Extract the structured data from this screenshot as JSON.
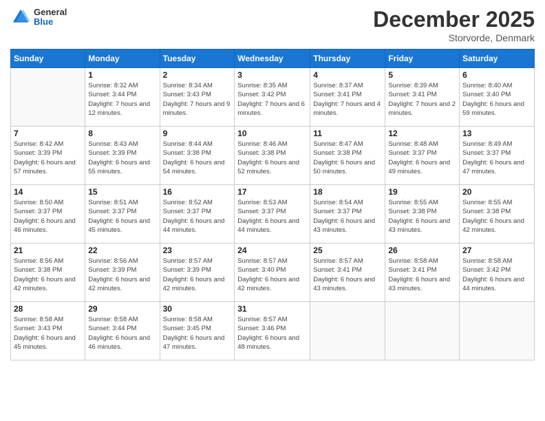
{
  "header": {
    "logo": {
      "general": "General",
      "blue": "Blue"
    },
    "title": "December 2025",
    "subtitle": "Storvorde, Denmark"
  },
  "calendar": {
    "days_of_week": [
      "Sunday",
      "Monday",
      "Tuesday",
      "Wednesday",
      "Thursday",
      "Friday",
      "Saturday"
    ],
    "weeks": [
      [
        {
          "day": "",
          "sunrise": "",
          "sunset": "",
          "daylight": ""
        },
        {
          "day": "1",
          "sunrise": "Sunrise: 8:32 AM",
          "sunset": "Sunset: 3:44 PM",
          "daylight": "Daylight: 7 hours and 12 minutes."
        },
        {
          "day": "2",
          "sunrise": "Sunrise: 8:34 AM",
          "sunset": "Sunset: 3:43 PM",
          "daylight": "Daylight: 7 hours and 9 minutes."
        },
        {
          "day": "3",
          "sunrise": "Sunrise: 8:35 AM",
          "sunset": "Sunset: 3:42 PM",
          "daylight": "Daylight: 7 hours and 6 minutes."
        },
        {
          "day": "4",
          "sunrise": "Sunrise: 8:37 AM",
          "sunset": "Sunset: 3:41 PM",
          "daylight": "Daylight: 7 hours and 4 minutes."
        },
        {
          "day": "5",
          "sunrise": "Sunrise: 8:39 AM",
          "sunset": "Sunset: 3:41 PM",
          "daylight": "Daylight: 7 hours and 2 minutes."
        },
        {
          "day": "6",
          "sunrise": "Sunrise: 8:40 AM",
          "sunset": "Sunset: 3:40 PM",
          "daylight": "Daylight: 6 hours and 59 minutes."
        }
      ],
      [
        {
          "day": "7",
          "sunrise": "Sunrise: 8:42 AM",
          "sunset": "Sunset: 3:39 PM",
          "daylight": "Daylight: 6 hours and 57 minutes."
        },
        {
          "day": "8",
          "sunrise": "Sunrise: 8:43 AM",
          "sunset": "Sunset: 3:39 PM",
          "daylight": "Daylight: 6 hours and 55 minutes."
        },
        {
          "day": "9",
          "sunrise": "Sunrise: 8:44 AM",
          "sunset": "Sunset: 3:38 PM",
          "daylight": "Daylight: 6 hours and 54 minutes."
        },
        {
          "day": "10",
          "sunrise": "Sunrise: 8:46 AM",
          "sunset": "Sunset: 3:38 PM",
          "daylight": "Daylight: 6 hours and 52 minutes."
        },
        {
          "day": "11",
          "sunrise": "Sunrise: 8:47 AM",
          "sunset": "Sunset: 3:38 PM",
          "daylight": "Daylight: 6 hours and 50 minutes."
        },
        {
          "day": "12",
          "sunrise": "Sunrise: 8:48 AM",
          "sunset": "Sunset: 3:37 PM",
          "daylight": "Daylight: 6 hours and 49 minutes."
        },
        {
          "day": "13",
          "sunrise": "Sunrise: 8:49 AM",
          "sunset": "Sunset: 3:37 PM",
          "daylight": "Daylight: 6 hours and 47 minutes."
        }
      ],
      [
        {
          "day": "14",
          "sunrise": "Sunrise: 8:50 AM",
          "sunset": "Sunset: 3:37 PM",
          "daylight": "Daylight: 6 hours and 46 minutes."
        },
        {
          "day": "15",
          "sunrise": "Sunrise: 8:51 AM",
          "sunset": "Sunset: 3:37 PM",
          "daylight": "Daylight: 6 hours and 45 minutes."
        },
        {
          "day": "16",
          "sunrise": "Sunrise: 8:52 AM",
          "sunset": "Sunset: 3:37 PM",
          "daylight": "Daylight: 6 hours and 44 minutes."
        },
        {
          "day": "17",
          "sunrise": "Sunrise: 8:53 AM",
          "sunset": "Sunset: 3:37 PM",
          "daylight": "Daylight: 6 hours and 44 minutes."
        },
        {
          "day": "18",
          "sunrise": "Sunrise: 8:54 AM",
          "sunset": "Sunset: 3:37 PM",
          "daylight": "Daylight: 6 hours and 43 minutes."
        },
        {
          "day": "19",
          "sunrise": "Sunrise: 8:55 AM",
          "sunset": "Sunset: 3:38 PM",
          "daylight": "Daylight: 6 hours and 43 minutes."
        },
        {
          "day": "20",
          "sunrise": "Sunrise: 8:55 AM",
          "sunset": "Sunset: 3:38 PM",
          "daylight": "Daylight: 6 hours and 42 minutes."
        }
      ],
      [
        {
          "day": "21",
          "sunrise": "Sunrise: 8:56 AM",
          "sunset": "Sunset: 3:38 PM",
          "daylight": "Daylight: 6 hours and 42 minutes."
        },
        {
          "day": "22",
          "sunrise": "Sunrise: 8:56 AM",
          "sunset": "Sunset: 3:39 PM",
          "daylight": "Daylight: 6 hours and 42 minutes."
        },
        {
          "day": "23",
          "sunrise": "Sunrise: 8:57 AM",
          "sunset": "Sunset: 3:39 PM",
          "daylight": "Daylight: 6 hours and 42 minutes."
        },
        {
          "day": "24",
          "sunrise": "Sunrise: 8:57 AM",
          "sunset": "Sunset: 3:40 PM",
          "daylight": "Daylight: 6 hours and 42 minutes."
        },
        {
          "day": "25",
          "sunrise": "Sunrise: 8:57 AM",
          "sunset": "Sunset: 3:41 PM",
          "daylight": "Daylight: 6 hours and 43 minutes."
        },
        {
          "day": "26",
          "sunrise": "Sunrise: 8:58 AM",
          "sunset": "Sunset: 3:41 PM",
          "daylight": "Daylight: 6 hours and 43 minutes."
        },
        {
          "day": "27",
          "sunrise": "Sunrise: 8:58 AM",
          "sunset": "Sunset: 3:42 PM",
          "daylight": "Daylight: 6 hours and 44 minutes."
        }
      ],
      [
        {
          "day": "28",
          "sunrise": "Sunrise: 8:58 AM",
          "sunset": "Sunset: 3:43 PM",
          "daylight": "Daylight: 6 hours and 45 minutes."
        },
        {
          "day": "29",
          "sunrise": "Sunrise: 8:58 AM",
          "sunset": "Sunset: 3:44 PM",
          "daylight": "Daylight: 6 hours and 46 minutes."
        },
        {
          "day": "30",
          "sunrise": "Sunrise: 8:58 AM",
          "sunset": "Sunset: 3:45 PM",
          "daylight": "Daylight: 6 hours and 47 minutes."
        },
        {
          "day": "31",
          "sunrise": "Sunrise: 8:57 AM",
          "sunset": "Sunset: 3:46 PM",
          "daylight": "Daylight: 6 hours and 48 minutes."
        },
        {
          "day": "",
          "sunrise": "",
          "sunset": "",
          "daylight": ""
        },
        {
          "day": "",
          "sunrise": "",
          "sunset": "",
          "daylight": ""
        },
        {
          "day": "",
          "sunrise": "",
          "sunset": "",
          "daylight": ""
        }
      ]
    ]
  }
}
